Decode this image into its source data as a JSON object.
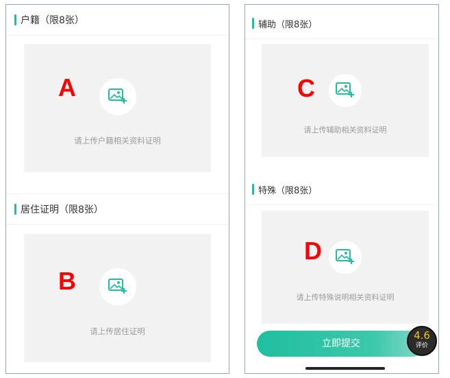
{
  "left_panel": {
    "section1": {
      "title": "户籍（限8张）",
      "hint": "请上传户籍相关资料证明",
      "letter": "A"
    },
    "section2": {
      "title": "居住证明（限8张）",
      "hint": "请上传居住证明",
      "letter": "B"
    }
  },
  "right_panel": {
    "section1": {
      "title": "辅助（限8张）",
      "hint": "请上传辅助相关资料证明",
      "letter": "C"
    },
    "section2": {
      "title": "特殊（限8张）",
      "hint": "请上传特殊说明相关资料证明",
      "letter": "D"
    },
    "submit_label": "立即提交",
    "rating": {
      "score": "4.6",
      "label": "评价"
    }
  },
  "icons": {
    "upload": "image-add-icon"
  },
  "colors": {
    "accent": "#1fbf9e",
    "upload_bg": "#f2f2f2",
    "annotation": "#ff0000"
  }
}
